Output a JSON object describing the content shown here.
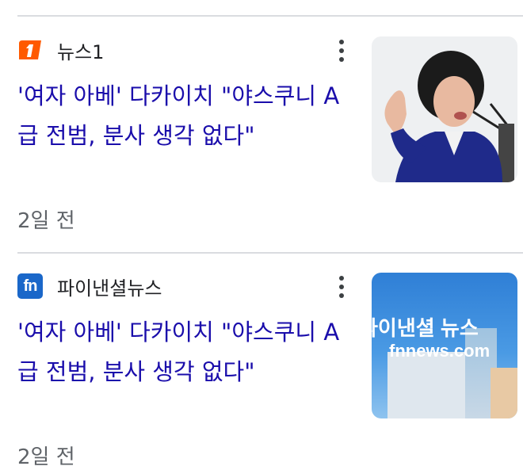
{
  "colors": {
    "headline": "#1a0dab",
    "news1_brand": "#ff5a00",
    "fn_brand": "#1a67c9"
  },
  "items": [
    {
      "source": "뉴스1",
      "source_icon": "news1-logo",
      "headline": "'여자 아베' 다카이치 \"야스쿠니 A급 전범, 분사 생각 없다\"",
      "date": "2일 전"
    },
    {
      "source": "파이낸셜뉴스",
      "source_icon": "fn-logo",
      "source_logo_text": "fn",
      "headline": "'여자 아베' 다카이치 \"야스쿠니 A급 전범, 분사 생각 없다\"",
      "thumbnail_text_top": "파이낸셜 뉴스",
      "thumbnail_text_site": "fnnews.com",
      "date": "2일 전"
    }
  ]
}
